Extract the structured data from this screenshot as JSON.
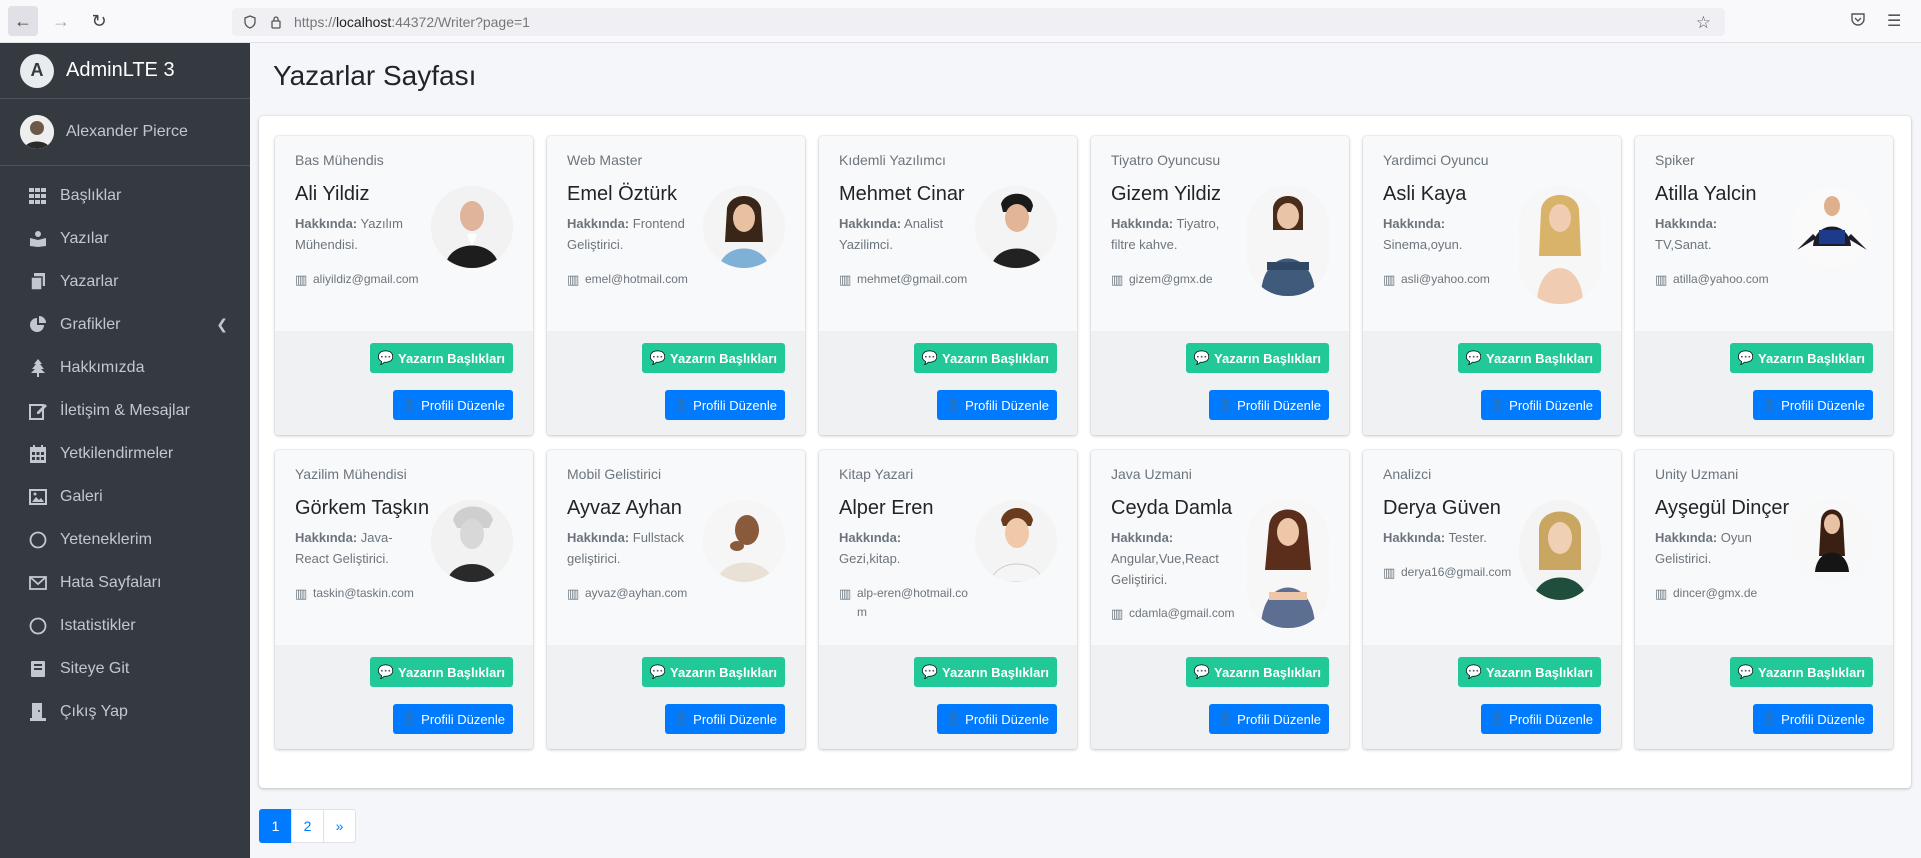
{
  "browser": {
    "url_prefix": "https://",
    "url_host": "localhost",
    "url_rest": ":44372/Writer?page=1",
    "back_icon": "arrow-left-icon",
    "forward_icon": "arrow-right-icon",
    "reload_icon": "reload-icon"
  },
  "sidebar": {
    "brand": "AdminLTE 3",
    "user": "Alexander Pierce",
    "items": [
      {
        "label": "Başlıklar",
        "icon": "grid-icon"
      },
      {
        "label": "Yazılar",
        "icon": "reader-icon"
      },
      {
        "label": "Yazarlar",
        "icon": "copy-icon"
      },
      {
        "label": "Grafikler",
        "icon": "pie-chart-icon"
      },
      {
        "label": "Hakkımızda",
        "icon": "tree-icon"
      },
      {
        "label": "İletişim & Mesajlar",
        "icon": "edit-icon"
      },
      {
        "label": "Yetkilendirmeler",
        "icon": "calendar-icon"
      },
      {
        "label": "Galeri",
        "icon": "image-icon"
      },
      {
        "label": "Yeteneklerim",
        "icon": "circle-icon"
      },
      {
        "label": "Hata Sayfaları",
        "icon": "envelope-icon"
      },
      {
        "label": "Istatistikler",
        "icon": "circle-icon"
      },
      {
        "label": "Siteye Git",
        "icon": "book-icon"
      },
      {
        "label": "Çıkış Yap",
        "icon": "logout-icon"
      }
    ]
  },
  "page": {
    "title": "Yazarlar Sayfası"
  },
  "card_labels": {
    "about": "Hakkında:",
    "titles_button": "Yazarın Başlıkları",
    "edit_button": "Profili Düzenle"
  },
  "writers": [
    {
      "role": "Bas Mühendis",
      "name": "Ali Yildiz",
      "about": "Yazılım Mühendisi.",
      "email": "aliyildiz@gmail.com"
    },
    {
      "role": "Web Master",
      "name": "Emel Öztürk",
      "about": "Frontend Geliştirici.",
      "email": "emel@hotmail.com"
    },
    {
      "role": "Kıdemli Yazılımcı",
      "name": "Mehmet Cinar",
      "about": "Analist Yazilimci.",
      "email": "mehmet@gmail.com"
    },
    {
      "role": "Tiyatro Oyuncusu",
      "name": "Gizem Yildiz",
      "about": "Tiyatro, filtre kahve.",
      "email": "gizem@gmx.de"
    },
    {
      "role": "Yardimci Oyuncu",
      "name": "Asli Kaya",
      "about": "Sinema,oyun.",
      "email": "asli@yahoo.com"
    },
    {
      "role": "Spiker",
      "name": "Atilla Yalcin",
      "about": "TV,Sanat.",
      "email": "atilla@yahoo.com"
    },
    {
      "role": "Yazilim Mühendisi",
      "name": "Görkem Taşkın",
      "about": "Java-React Geliştirici.",
      "email": "taskin@taskin.com"
    },
    {
      "role": "Mobil Gelistirici",
      "name": "Ayvaz Ayhan",
      "about": "Fullstack geliştirici.",
      "email": "ayvaz@ayhan.com"
    },
    {
      "role": "Kitap Yazari",
      "name": "Alper Eren",
      "about": "Gezi,kitap.",
      "email": "alp-eren@hotmail.com"
    },
    {
      "role": "Java Uzmani",
      "name": "Ceyda Damla",
      "about": "Angular,Vue,React Geliştirici.",
      "email": "cdamla@gmail.com"
    },
    {
      "role": "Analizci",
      "name": "Derya Güven",
      "about": "Tester.",
      "email": "derya16@gmail.com"
    },
    {
      "role": "Unity Uzmani",
      "name": "Ayşegül Dinçer",
      "about": "Oyun Gelistirici.",
      "email": "dincer@gmx.de"
    }
  ],
  "pagination": [
    "1",
    "2",
    "»"
  ]
}
